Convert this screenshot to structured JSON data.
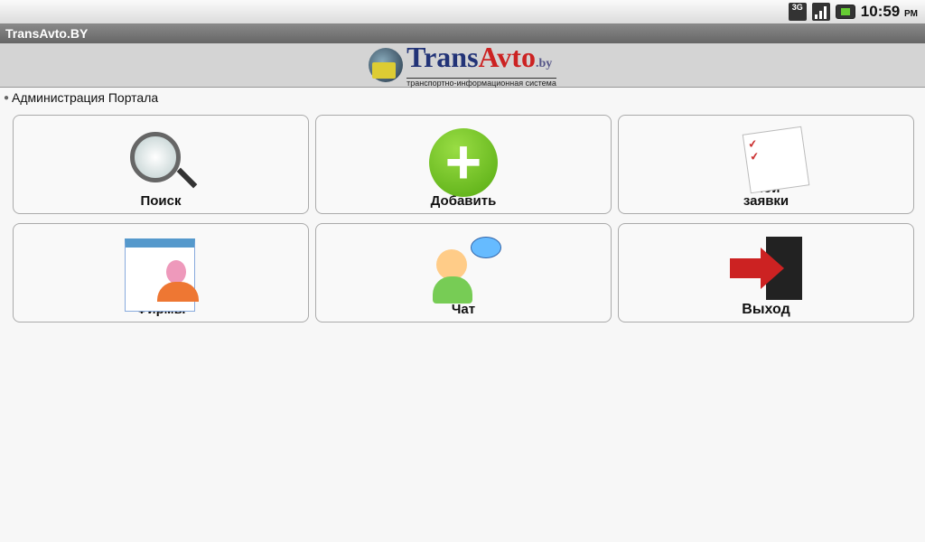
{
  "status": {
    "network": "3G",
    "time": "10:59",
    "ampm": "PM"
  },
  "app_title": "TransAvto.BY",
  "logo": {
    "main": "Trans",
    "accent": "Avto",
    "tld": ".by",
    "tagline": "транспортно-информационная система"
  },
  "section": "Администрация Портала",
  "tiles": [
    {
      "label": "Поиск"
    },
    {
      "label": "Добавить"
    },
    {
      "label": "Мои заявки"
    },
    {
      "label": "Фирмы"
    },
    {
      "label": "Чат"
    },
    {
      "label": "Выход"
    }
  ]
}
